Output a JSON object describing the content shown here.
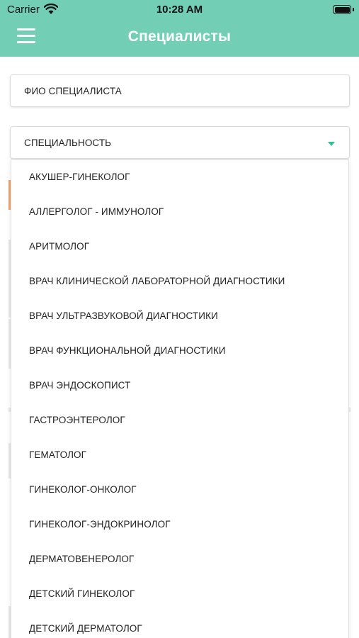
{
  "status_bar": {
    "carrier": "Carrier",
    "time": "10:28 AM"
  },
  "header": {
    "title": "Специалисты",
    "background": "#72cfb5"
  },
  "filters": {
    "name_placeholder": "ФИО СПЕЦИАЛИСТА",
    "specialty_label": "СПЕЦИАЛЬНОСТЬ",
    "caret_color": "#2fbf95"
  },
  "dropdown": {
    "options": [
      "АКУШЕР-ГИНЕКОЛОГ",
      "АЛЛЕРГОЛОГ - ИММУНОЛОГ",
      "АРИТМОЛОГ",
      "ВРАЧ КЛИНИЧЕСКОЙ ЛАБОРАТОРНОЙ ДИАГНОСТИКИ",
      "ВРАЧ УЛЬТРАЗВУКОВОЙ ДИАГНОСТИКИ",
      "ВРАЧ ФУНКЦИОНАЛЬНОЙ ДИАГНОСТИКИ",
      "ВРАЧ ЭНДОСКОПИСТ",
      "ГАСТРОЭНТЕРОЛОГ",
      "ГЕМАТОЛОГ",
      "ГИНЕКОЛОГ-ОНКОЛОГ",
      "ГИНЕКОЛОГ-ЭНДОКРИНОЛОГ",
      "ДЕРМАТОВЕНЕРОЛОГ",
      "ДЕТСКИЙ ГИНЕКОЛОГ",
      "ДЕТСКИЙ ДЕРМАТОЛОГ"
    ]
  }
}
